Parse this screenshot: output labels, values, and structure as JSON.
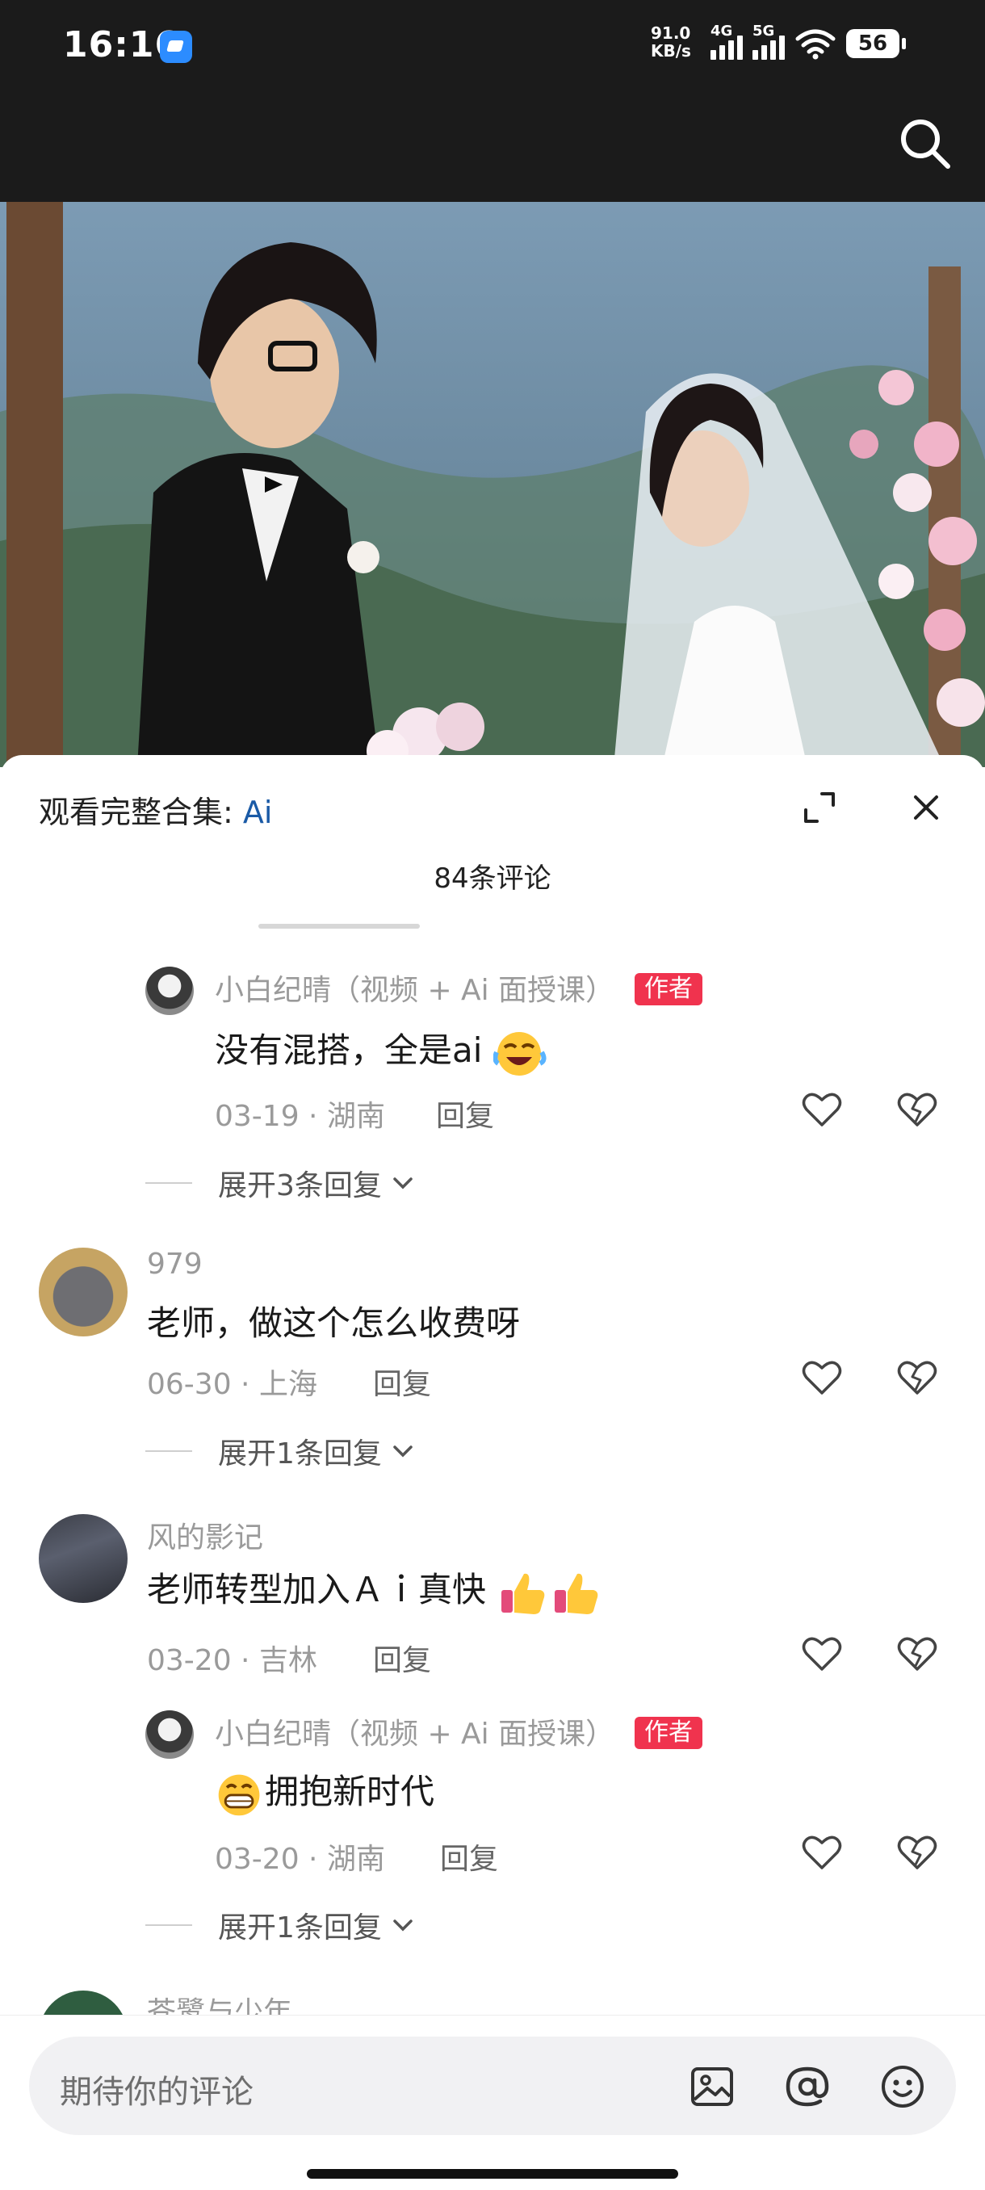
{
  "status_bar": {
    "time": "16:16",
    "net_speed_value": "91.0",
    "net_speed_unit": "KB/s",
    "sig1_label": "4G",
    "sig2_label": "5G",
    "battery": "56"
  },
  "sheet": {
    "title_prefix": "观看完整合集: ",
    "title_link": "Ai",
    "count_label": "84条评论"
  },
  "comments": [
    {
      "username": "小白纪晴（视频 + Ai 面授课）",
      "author_tag": "作者",
      "text": "没有混搭，全是ai",
      "date": "03-19",
      "location": "湖南",
      "reply_label": "回复",
      "expand_label": "展开3条回复"
    },
    {
      "username": "979",
      "text": "老师，做这个怎么收费呀",
      "date": "06-30",
      "location": "上海",
      "reply_label": "回复",
      "expand_label": "展开1条回复"
    },
    {
      "username": "风的影记",
      "text": "老师转型加入Ａｉ真快",
      "date": "03-20",
      "location": "吉林",
      "reply_label": "回复"
    },
    {
      "username": "小白纪晴（视频 + Ai 面授课）",
      "author_tag": "作者",
      "text": "拥抱新时代",
      "date": "03-20",
      "location": "湖南",
      "reply_label": "回复",
      "expand_label": "展开1条回复"
    },
    {
      "username": "苍鹭与少年"
    }
  ],
  "input": {
    "placeholder": "期待你的评论"
  },
  "icons": {
    "search": "search-icon",
    "expand": "expand-icon",
    "close": "close-icon",
    "heart": "heart-icon",
    "dislike": "dislike-icon",
    "image": "image-icon",
    "mention": "at-icon",
    "emoji": "emoji-icon"
  },
  "colors": {
    "author_tag": "#f0334e",
    "link": "#1a5aa6"
  }
}
